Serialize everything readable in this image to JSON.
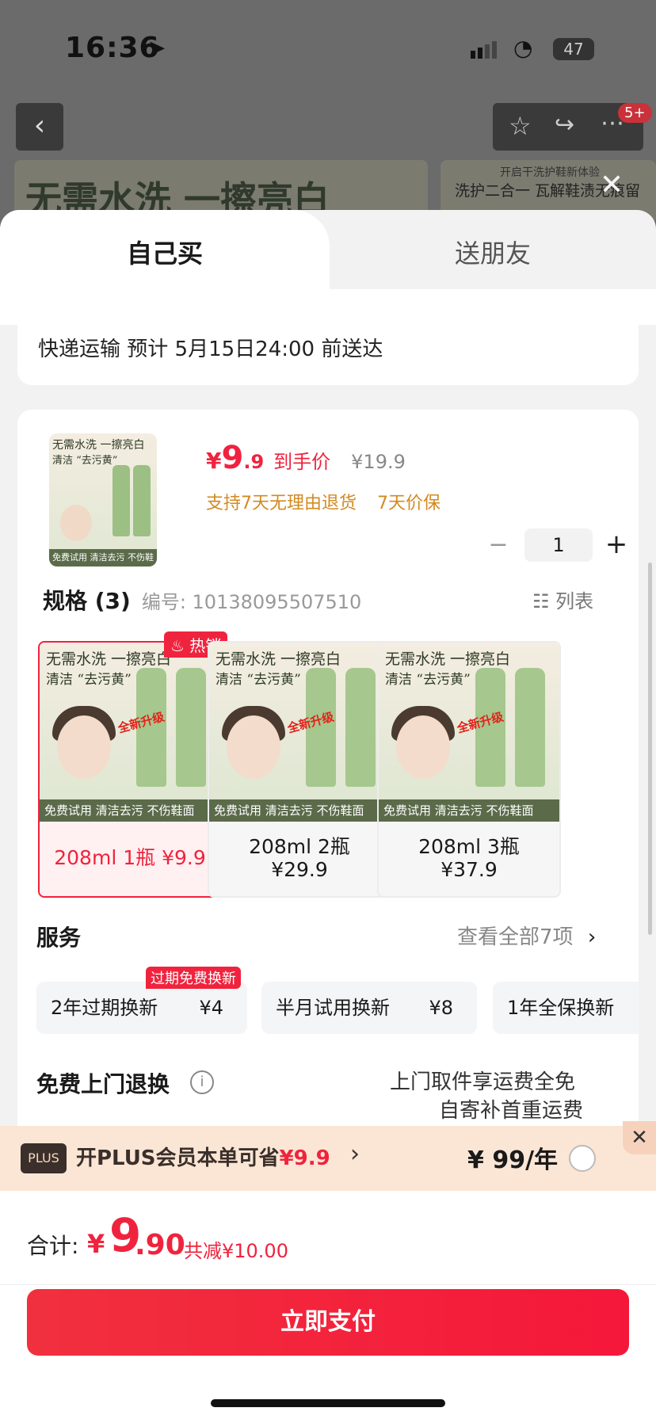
{
  "status": {
    "time": "16:36",
    "battery": "47"
  },
  "backdrop": {
    "badge": "5+",
    "banner_left": "无需水洗 一擦亮白",
    "banner_right_top": "开启干洗护鞋新体验",
    "banner_right_main": "洗护二合一 瓦解鞋渍无痕留"
  },
  "tabs": {
    "self": "自己买",
    "gift": "送朋友"
  },
  "delivery": "快递运输 预计 5月15日24:00 前送达",
  "product": {
    "currency": "¥",
    "price_int": "9",
    "price_dec": ".9",
    "price_tag": "到手价",
    "orig_price": "¥19.9",
    "service_1": "支持7天无理由退货",
    "service_2": "7天价保",
    "qty_minus": "−",
    "quantity": "1",
    "qty_plus": "+",
    "thumb_line1": "无需水洗 一擦亮白",
    "thumb_line2": "清洁 “去污黄”",
    "thumb_footer": "免费试用 清洁去污 不伤鞋面"
  },
  "spec": {
    "title": "规格 (3)",
    "code": "编号: 10138095507510",
    "list_toggle": "列表",
    "hot_badge": "热销",
    "img_line1": "无需水洗 一擦亮白",
    "img_line2": "清洁 “去污黄”",
    "img_badge": "全新升级",
    "img_footer": "免费试用 清洁去污 不伤鞋面",
    "variants": [
      {
        "label": "208ml 1瓶 ¥9.9"
      },
      {
        "label_l1": "208ml 2瓶",
        "label_l2": "¥29.9"
      },
      {
        "label_l1": "208ml 3瓶",
        "label_l2": "¥37.9"
      }
    ]
  },
  "services": {
    "title": "服务",
    "more": "查看全部7项",
    "tag": "过期免费换新",
    "items": [
      {
        "name": "2年过期换新",
        "fee": "¥4"
      },
      {
        "name": "半月试用换新",
        "fee": "¥8"
      },
      {
        "name": "1年全保换新",
        "fee": ""
      }
    ]
  },
  "returns": {
    "title": "免费上门退换",
    "line1": "上门取件享运费全免",
    "line2": "自寄补首重运费"
  },
  "plus": {
    "logo": "PLUS",
    "text": "开PLUS会员本单可省",
    "save": "¥9.9",
    "price": "¥ 99/年"
  },
  "footer": {
    "total_label": "合计:",
    "currency": "¥",
    "total_int": "9",
    "total_dec": ".90",
    "saving": "共减¥10.00",
    "pay": "立即支付"
  },
  "colors": {
    "accent": "#f0233e",
    "service_orange": "#d38a21"
  }
}
